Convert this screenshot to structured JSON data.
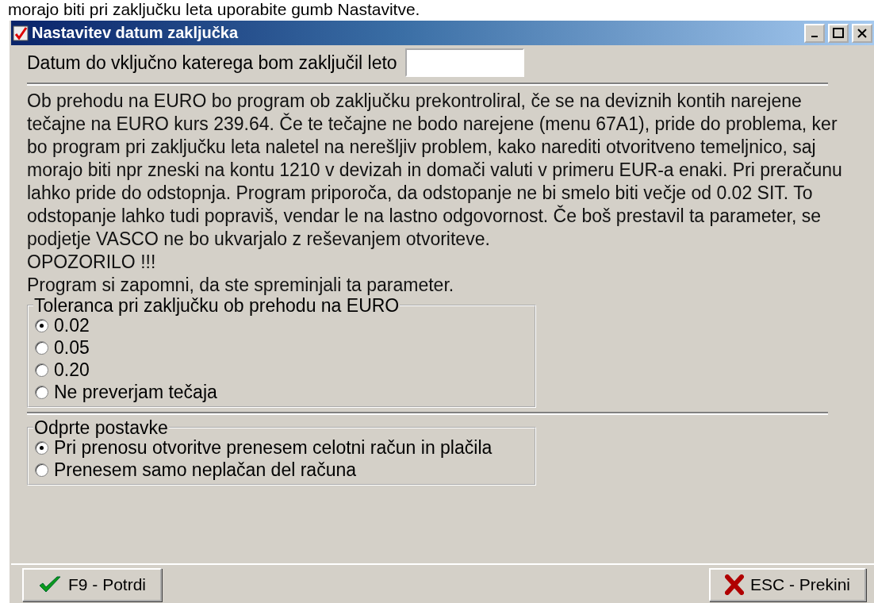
{
  "caption": "morajo biti pri zaključku leta uporabite gumb Nastavitve.",
  "window": {
    "title": "Nastavitev datum zaključka"
  },
  "date_field": {
    "label": "Datum do vključno katerega bom zaključil leto"
  },
  "description": [
    "Ob prehodu na EURO bo program ob zaključku prekontroliral, če se na deviznih kontih narejene tečajne na EURO kurs 239.64. Če te tečajne ne bodo narejene (menu 67A1), pride do problema, ker bo program pri zaključku leta naletel na nerešljiv problem, kako narediti otvoritveno temeljnico, saj morajo biti npr zneski na kontu 1210 v devizah in domači valuti v primeru EUR-a enaki. Pri preračunu lahko pride do odstopnja. Program priporoča, da odstopanje ne bi smelo biti večje od 0.02 SIT. To odstopanje lahko tudi popraviš, vendar le na lastno odgovornost. Če boš prestavil ta parameter, se podjetje VASCO ne bo ukvarjalo z reševanjem otvoriteve.",
    "OPOZORILO !!!",
    "Program si zapomni, da ste spreminjali ta parameter."
  ],
  "groups": [
    {
      "title": "Toleranca pri zaključku ob prehodu na EURO",
      "options": [
        {
          "label": "0.02",
          "selected": true
        },
        {
          "label": "0.05",
          "selected": false
        },
        {
          "label": "0.20",
          "selected": false
        },
        {
          "label": "Ne preverjam tečaja",
          "selected": false
        }
      ]
    },
    {
      "title": "Odprte postavke",
      "options": [
        {
          "label": "Pri prenosu otvoritve prenesem celotni račun in plačila",
          "selected": true
        },
        {
          "label": "Prenesem samo neplačan del računa",
          "selected": false
        }
      ]
    }
  ],
  "buttons": [
    {
      "kind": "confirm",
      "label": "F9 - Potrdi"
    },
    {
      "kind": "cancel",
      "label": "ESC - Prekini"
    }
  ]
}
